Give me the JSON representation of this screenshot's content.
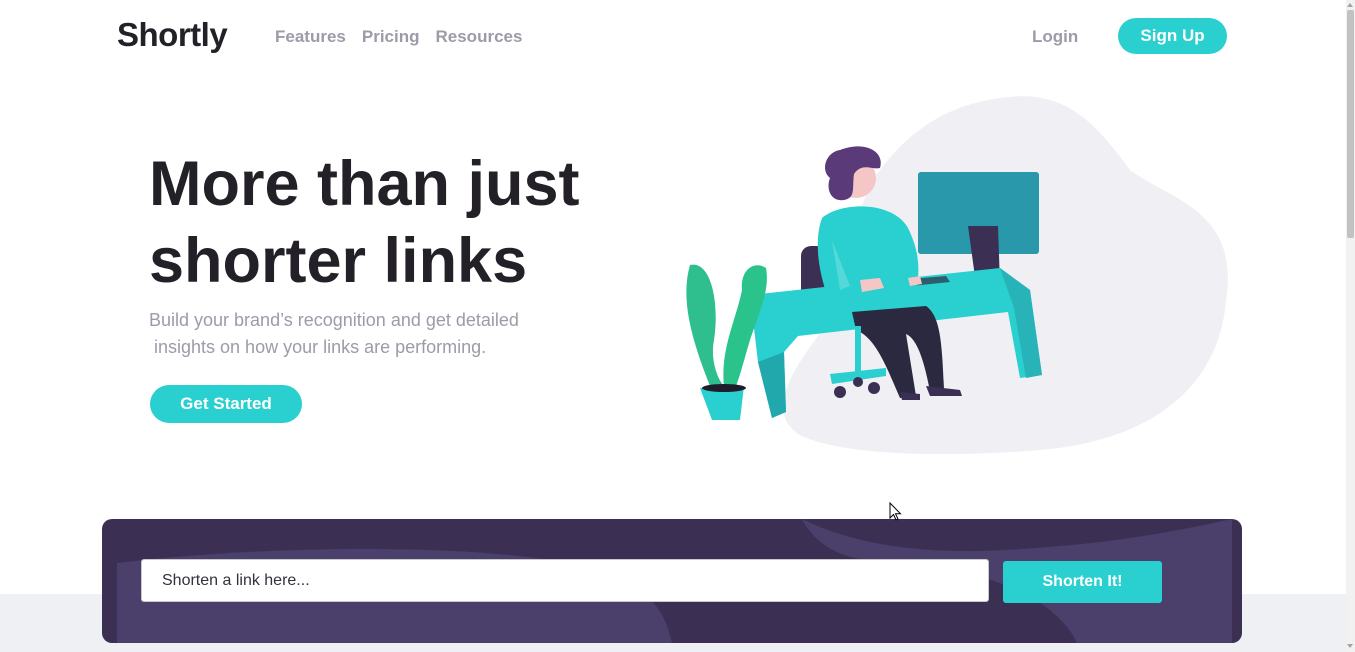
{
  "header": {
    "logo": "Shortly",
    "nav": [
      "Features",
      "Pricing",
      "Resources"
    ],
    "login_label": "Login",
    "signup_label": "Sign Up"
  },
  "hero": {
    "title_line1": "More than just",
    "title_line2": "shorter links",
    "subtitle_line1": "Build your brand’s recognition and get detailed",
    "subtitle_line2": "insights on how your links are performing.",
    "cta_label": "Get Started",
    "illustration": "person-working-at-desk-illustration"
  },
  "shorten": {
    "placeholder": "Shorten a link here...",
    "button_label": "Shorten It!"
  },
  "colors": {
    "accent": "#2acfcf",
    "dark_violet": "#3b3054",
    "very_dark": "#232127",
    "gray_text": "#9e9aa8"
  }
}
